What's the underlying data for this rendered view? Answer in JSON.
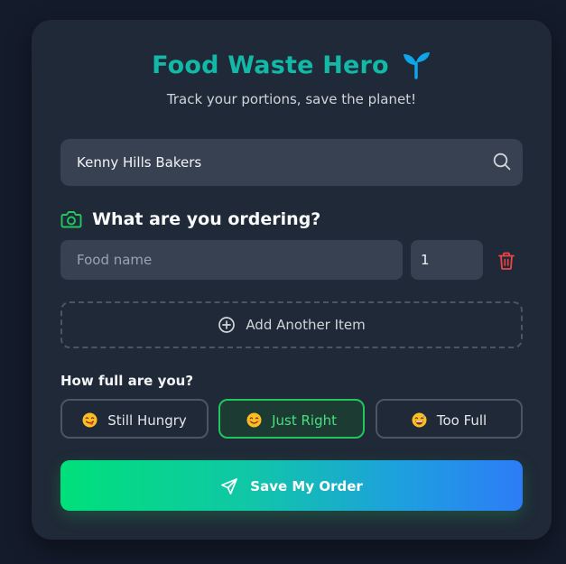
{
  "header": {
    "title": "Food Waste Hero",
    "subtitle": "Track your portions, save the planet!",
    "title_color": "#14b8a6",
    "title_icon": "sprout-icon"
  },
  "search": {
    "value": "Kenny Hills Bakers",
    "icon": "search-icon"
  },
  "order_section": {
    "icon": "camera-icon",
    "heading": "What are you ordering?",
    "items": [
      {
        "food_placeholder": "Food name",
        "food_value": "",
        "quantity": "1",
        "delete_icon": "trash-icon"
      }
    ],
    "add_item_label": "Add Another Item",
    "add_item_icon": "plus-circle-icon"
  },
  "fullness": {
    "label": "How full are you?",
    "options": [
      {
        "emoji": "yum-face-icon",
        "label": "Still Hungry",
        "selected": false
      },
      {
        "emoji": "smiling-face-icon",
        "label": "Just Right",
        "selected": true
      },
      {
        "emoji": "grinning-sweat-face-icon",
        "label": "Too Full",
        "selected": false
      }
    ],
    "selected_color": "#22c55e"
  },
  "save_button": {
    "label": "Save My Order",
    "icon": "send-icon",
    "gradient": [
      "#00e07a",
      "#2d7cf7"
    ]
  }
}
